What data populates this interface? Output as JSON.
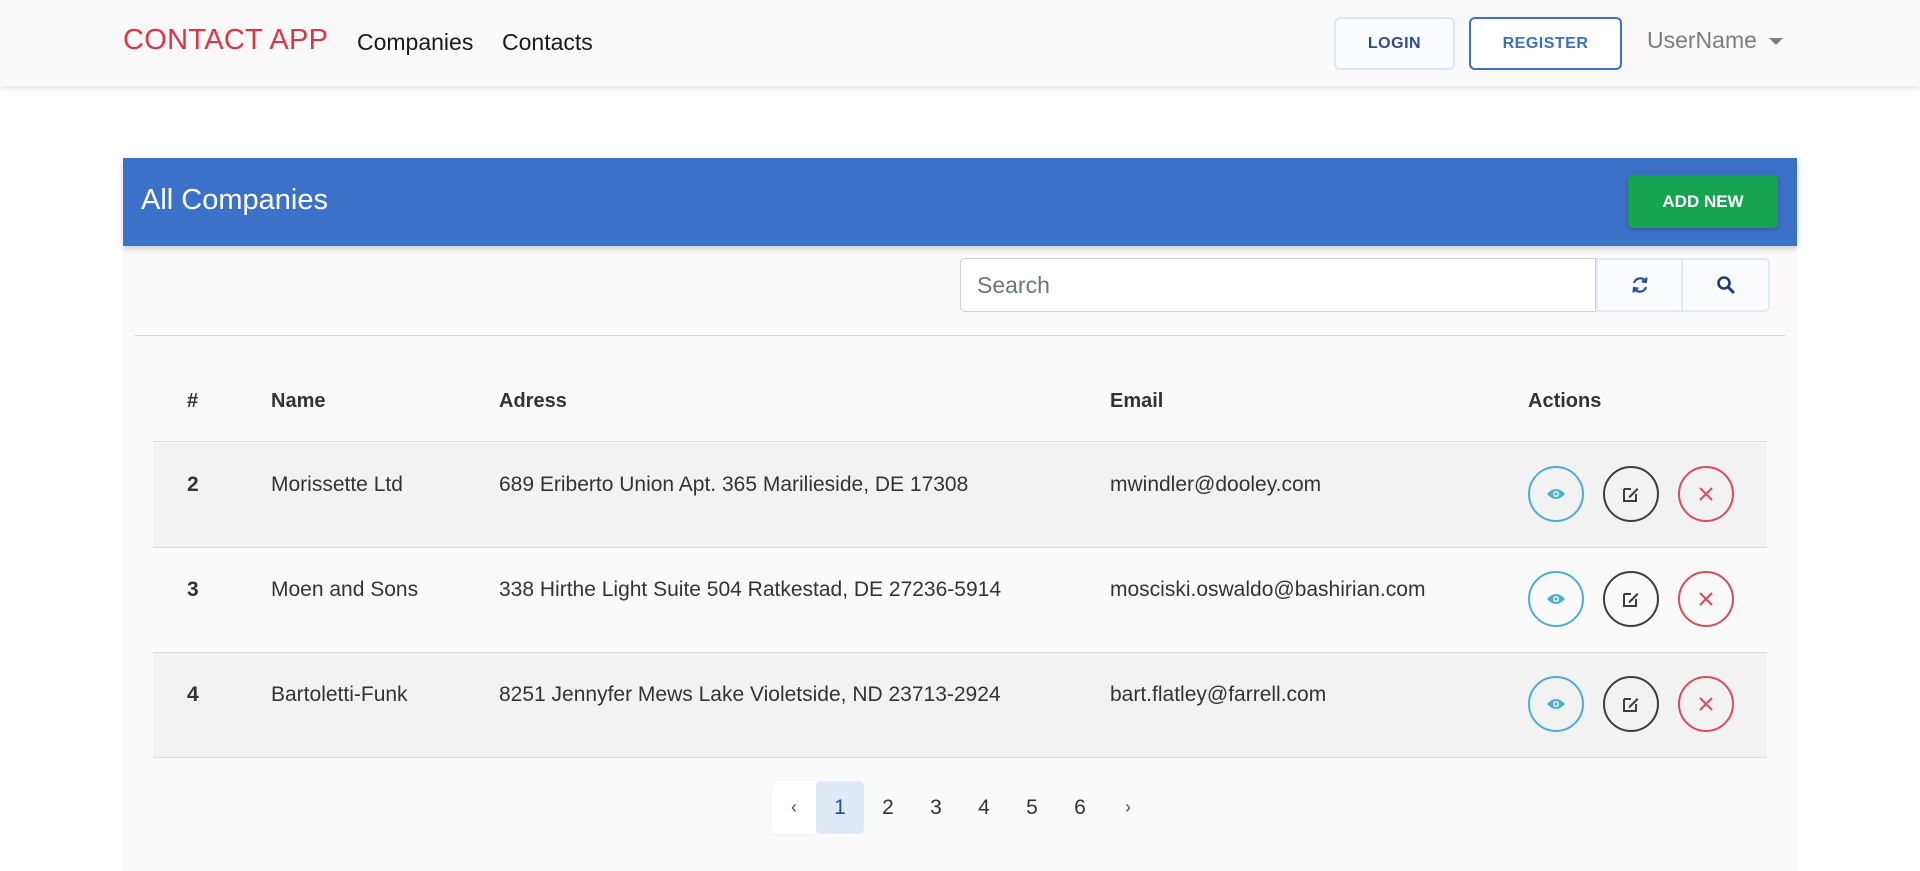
{
  "navbar": {
    "brand": "CONTACT APP",
    "links": [
      "Companies",
      "Contacts"
    ],
    "login_label": "LOGIN",
    "register_label": "REGISTER",
    "user_label": "UserName"
  },
  "card": {
    "title": "All Companies",
    "add_label": "ADD NEW",
    "search_placeholder": "Search"
  },
  "table": {
    "headers": [
      "#",
      "Name",
      "Adress",
      "Email",
      "Actions"
    ],
    "rows": [
      {
        "num": "2",
        "name": "Morissette Ltd",
        "address": "689 Eriberto Union Apt. 365 Marilieside, DE 17308",
        "email": "mwindler@dooley.com"
      },
      {
        "num": "3",
        "name": "Moen and Sons",
        "address": "338 Hirthe Light Suite 504 Ratkestad, DE 27236-5914",
        "email": "mosciski.oswaldo@bashirian.com"
      },
      {
        "num": "4",
        "name": "Bartoletti-Funk",
        "address": "8251 Jennyfer Mews Lake Violetside, ND 23713-2924",
        "email": "bart.flatley@farrell.com"
      }
    ]
  },
  "pagination": {
    "prev": "‹",
    "pages": [
      "1",
      "2",
      "3",
      "4",
      "5",
      "6"
    ],
    "next": "›",
    "active": "1"
  },
  "colors": {
    "brand": "#dc3545",
    "header": "#3c71c9",
    "add": "#17a450",
    "view": "#4ab0cf",
    "edit": "#3d3d3d",
    "delete": "#dc4a5c"
  },
  "icons": {
    "refresh": "refresh-icon",
    "search": "search-icon",
    "view": "eye-icon",
    "edit": "edit-icon",
    "delete": "close-icon",
    "dropdown": "caret-down-icon"
  }
}
